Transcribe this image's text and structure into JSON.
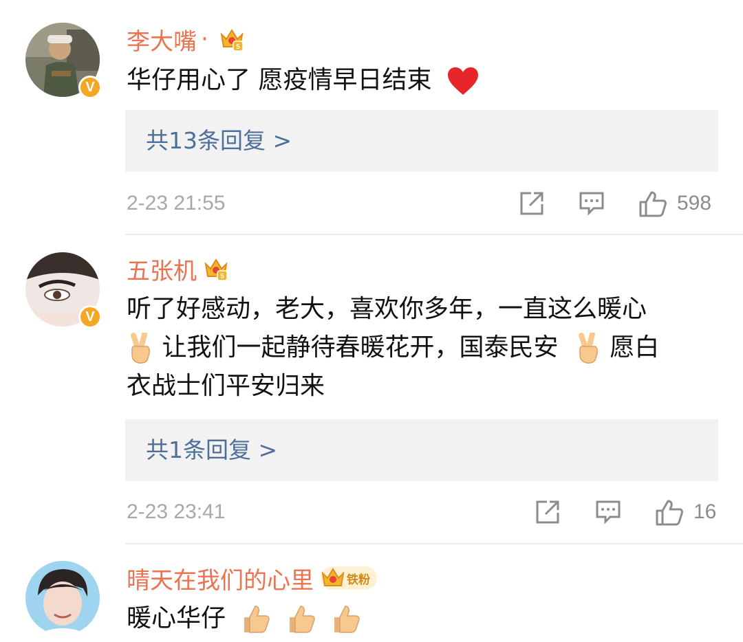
{
  "comments": [
    {
      "username": "李大嘴",
      "separator": "·",
      "badges": [
        "crown-badge"
      ],
      "verified": "V",
      "text_lines": [
        "华仔用心了 愿疫情早日结束"
      ],
      "emoji": "red-heart-icon",
      "reply_link": "共13条回复 >",
      "timestamp": "2-23 21:55",
      "like_count": "598"
    },
    {
      "username": "五张机",
      "badges": [
        "crown-badge"
      ],
      "verified": "V",
      "text_lines": [
        "听了好感动，老大，喜欢你多年，一直这么暖心",
        "让我们一起静待春暖花开，国泰民安",
        "愿白",
        "衣战士们平安归来"
      ],
      "emoji": "victory-hand-icon",
      "reply_link": "共1条回复 >",
      "timestamp": "2-23 23:41",
      "like_count": "16"
    },
    {
      "username": "晴天在我们的心里",
      "fan_badge_label": "铁粉",
      "text_lines": [
        "暖心华仔"
      ],
      "emoji": "thumbs-up-icon"
    }
  ],
  "colors": {
    "username": "#eb7350",
    "reply_link": "#4d6f9a",
    "reply_background": "#f2f2f2",
    "verified_badge": "#f5a623",
    "timestamp": "#a8a8a8"
  }
}
